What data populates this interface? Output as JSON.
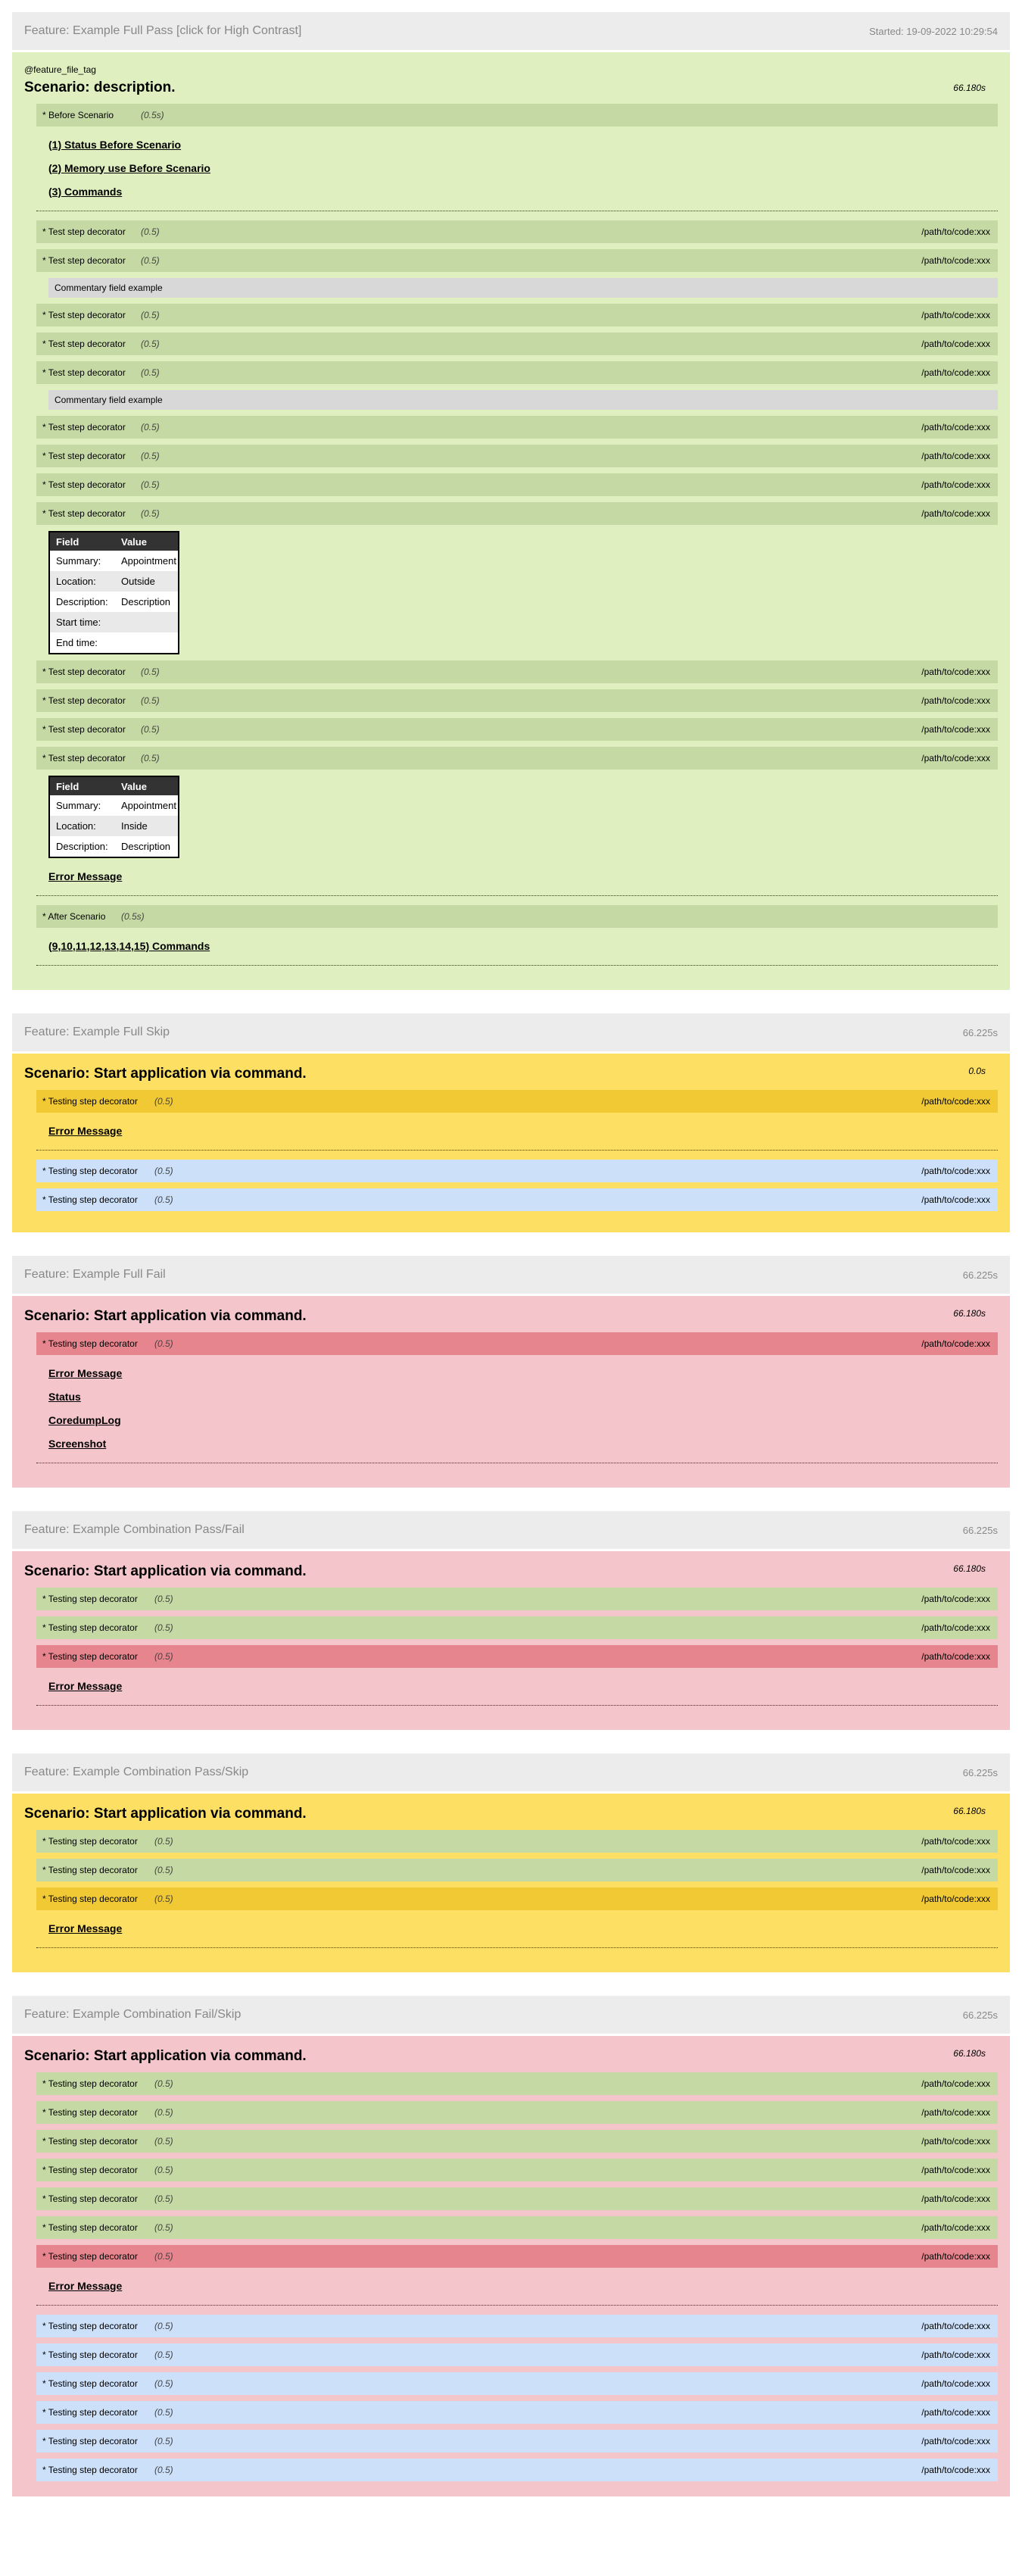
{
  "features": [
    {
      "title": "Feature: Example Full Pass [click for High Contrast]",
      "time": "Started: 19-09-2022 10:29:54",
      "scenario": {
        "tag": "@feature_file_tag",
        "title": "Scenario: description.",
        "time": "66.180s",
        "before": {
          "name": "* Before Scenario",
          "duration": "(0.5s)"
        },
        "before_links": [
          "(1) Status Before Scenario",
          "(2) Memory use Before Scenario",
          "(3) Commands"
        ],
        "comment": "Commentary field example",
        "table1": {
          "headers": [
            "Field",
            "Value"
          ],
          "rows": [
            [
              "Summary:",
              "Appointment"
            ],
            [
              "Location:",
              "Outside"
            ],
            [
              "Description:",
              "Description"
            ],
            [
              "Start time:",
              ""
            ],
            [
              "End time:",
              ""
            ]
          ]
        },
        "table2": {
          "headers": [
            "Field",
            "Value"
          ],
          "rows": [
            [
              "Summary:",
              "Appointment"
            ],
            [
              "Location:",
              "Inside"
            ],
            [
              "Description:",
              "Description"
            ]
          ]
        },
        "error_link": "Error Message",
        "after": {
          "name": "* After Scenario",
          "duration": "(0.5s)"
        },
        "after_link": "(9,10,11,12,13,14,15) Commands"
      }
    },
    {
      "title": "Feature: Example Full Skip",
      "time": "66.225s",
      "scenario": {
        "title": "Scenario: Start application via command.",
        "time": "0.0s",
        "error_link": "Error Message"
      }
    },
    {
      "title": "Feature: Example Full Fail",
      "time": "66.225s",
      "scenario": {
        "title": "Scenario: Start application via command.",
        "time": "66.180s",
        "links": [
          "Error Message",
          "Status",
          "CoredumpLog",
          "Screenshot"
        ]
      }
    },
    {
      "title": "Feature: Example Combination Pass/Fail",
      "time": "66.225s",
      "scenario": {
        "title": "Scenario: Start application via command.",
        "time": "66.180s",
        "error_link": "Error Message"
      }
    },
    {
      "title": "Feature: Example Combination Pass/Skip",
      "time": "66.225s",
      "scenario": {
        "title": "Scenario: Start application via command.",
        "time": "66.180s",
        "error_link": "Error Message"
      }
    },
    {
      "title": "Feature: Example Combination Fail/Skip",
      "time": "66.225s",
      "scenario": {
        "title": "Scenario: Start application via command.",
        "time": "66.180s",
        "error_link": "Error Message"
      }
    }
  ],
  "step": {
    "test_name": "* Test step decorator",
    "testing_name": "* Testing step decorator",
    "duration": "(0.5)",
    "path": "/path/to/code:xxx"
  },
  "colors": {
    "pass_bg": "#dfefc0",
    "skip_bg": "#fddf64",
    "fail_bg": "#f4c6cb",
    "step_pass": "#c5d9a4",
    "step_skip": "#f0c935",
    "step_fail": "#e6858e",
    "step_blue": "#cce0fa",
    "header_bg": "#ececec"
  }
}
